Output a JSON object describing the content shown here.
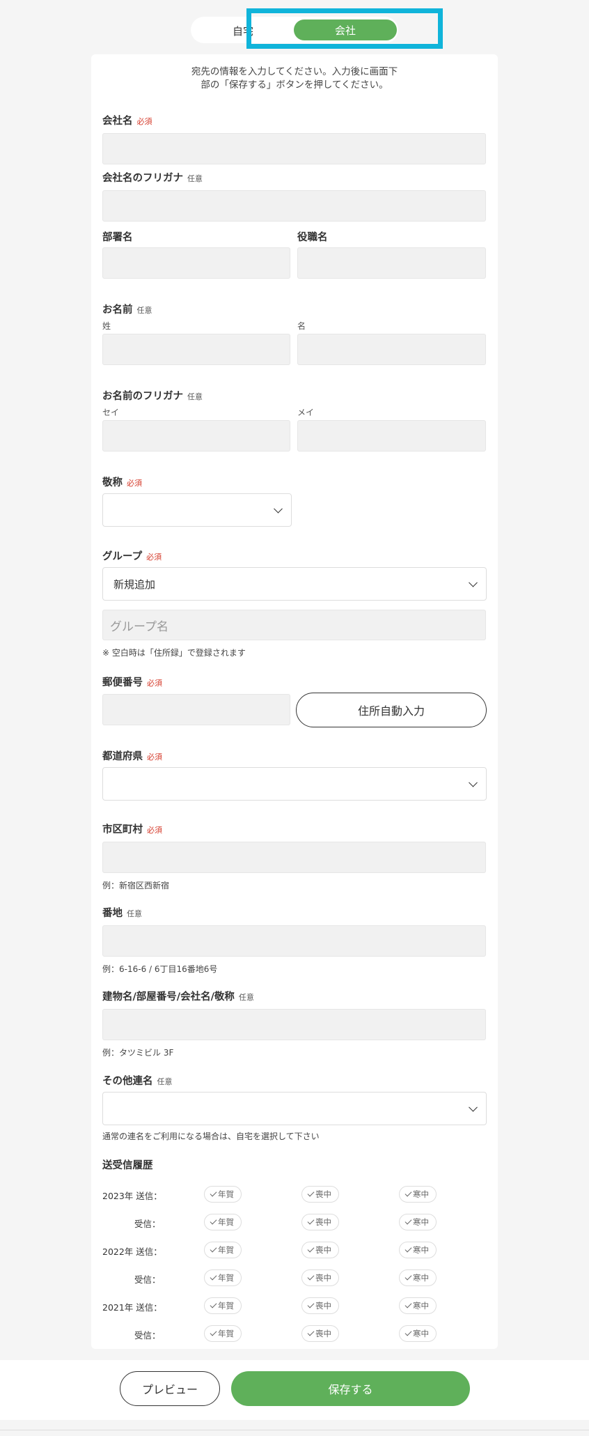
{
  "toggle": {
    "home": "自宅",
    "company": "会社"
  },
  "intro": {
    "line1": "宛先の情報を入力してください。入力後に画面下",
    "line2": "部の「保存する」ボタンを押してください。"
  },
  "tags": {
    "required": "必須",
    "optional": "任意"
  },
  "fields": {
    "company_name": "会社名",
    "company_kana": "会社名のフリガナ",
    "department": "部署名",
    "position": "役職名",
    "name": "お名前",
    "last": "姓",
    "first": "名",
    "name_kana": "お名前のフリガナ",
    "sei": "セイ",
    "mei": "メイ",
    "honorific": "敬称",
    "group": "グループ",
    "group_selected": "新規追加",
    "group_placeholder": "グループ名",
    "group_hint": "※ 空白時は「住所録」で登録されます",
    "postal": "郵便番号",
    "auto_address": "住所自動入力",
    "prefecture": "都道府県",
    "city": "市区町村",
    "city_hint": "例：新宿区西新宿",
    "street": "番地",
    "street_hint": "例：6-16-6 / 6丁目16番地6号",
    "building": "建物名/部屋番号/会社名/敬称",
    "building_hint": "例：タツミビル 3F",
    "joint": "その他連名",
    "joint_hint": "通常の連名をご利用になる場合は、自宅を選択して下さい"
  },
  "history": {
    "title": "送受信履歴",
    "rows": [
      {
        "label": "2023年 送信："
      },
      {
        "label": "受信："
      },
      {
        "label": "2022年 送信："
      },
      {
        "label": "受信："
      },
      {
        "label": "2021年 送信："
      },
      {
        "label": "受信："
      }
    ],
    "chips": [
      "年賀",
      "喪中",
      "寒中"
    ]
  },
  "footer": {
    "preview": "プレビュー",
    "save": "保存する"
  },
  "colors": {
    "accent": "#5fb05a",
    "highlight": "#10b4da",
    "required": "#d53b2b"
  }
}
